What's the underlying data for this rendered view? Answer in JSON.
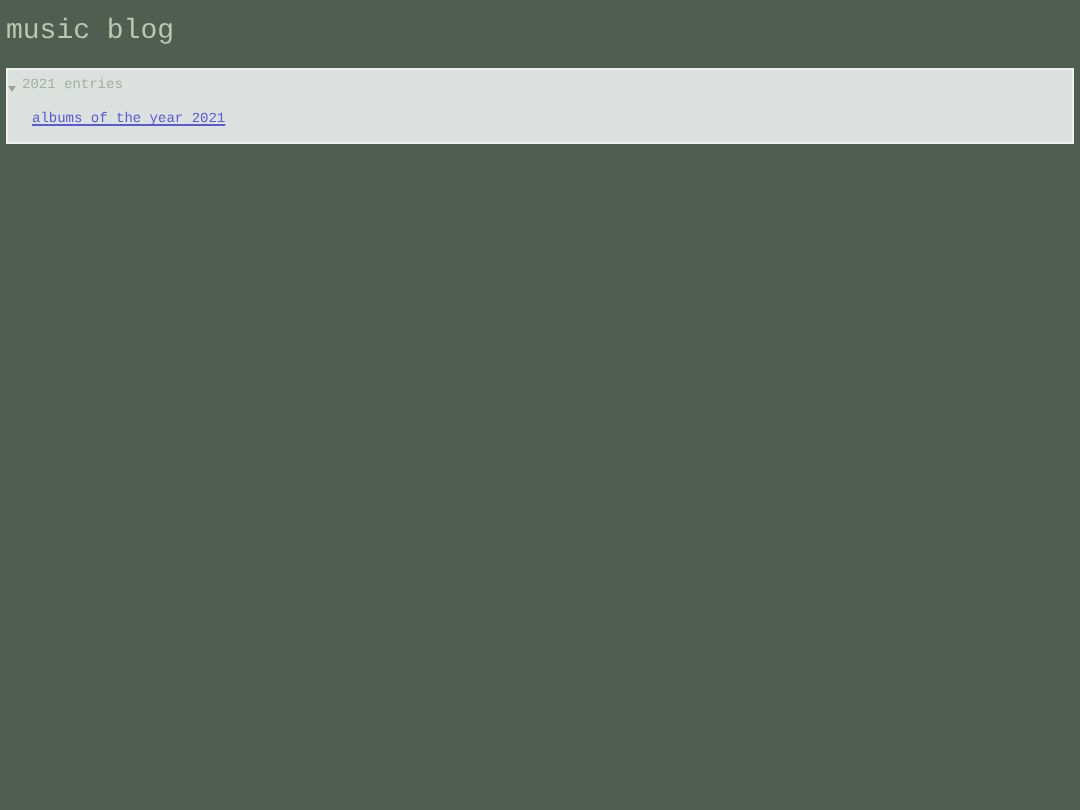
{
  "header": {
    "title": "music blog"
  },
  "sections": [
    {
      "label": "2021 entries",
      "expanded": true,
      "links": [
        "albums of the year 2021"
      ]
    }
  ]
}
